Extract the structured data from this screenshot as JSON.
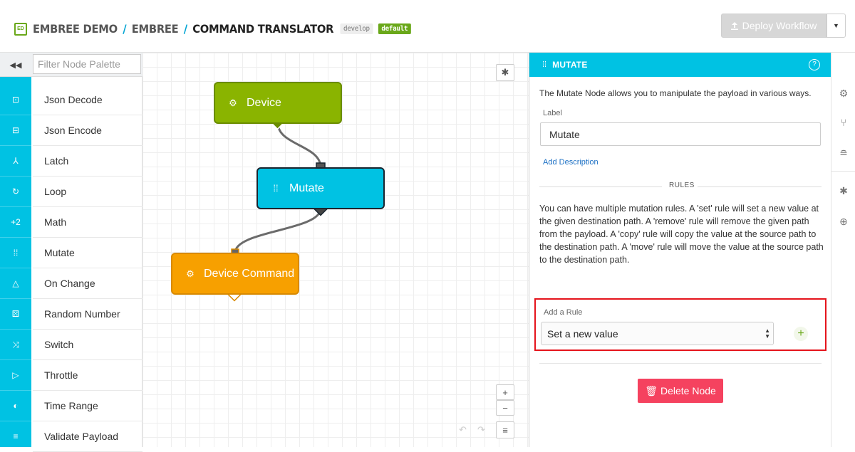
{
  "header": {
    "logo_text": "ED",
    "breadcrumbs": [
      "EMBREE DEMO",
      "EMBREE",
      "COMMAND TRANSLATOR"
    ],
    "separator": "/",
    "version_tag": "develop",
    "default_tag": "default",
    "deploy_label": "Deploy Workflow",
    "deploy_icon": "upload-icon",
    "caret_icon": "caret-down-icon"
  },
  "palette": {
    "filter_placeholder": "Filter Node Palette",
    "collapse_icon": "double-chevron-left-icon",
    "items": [
      {
        "label": "Json Decode",
        "icon": "json-decode-icon",
        "glyph": "⊡"
      },
      {
        "label": "Json Encode",
        "icon": "json-encode-icon",
        "glyph": "⊟"
      },
      {
        "label": "Latch",
        "icon": "latch-icon",
        "glyph": "⅄"
      },
      {
        "label": "Loop",
        "icon": "loop-icon",
        "glyph": "↻"
      },
      {
        "label": "Math",
        "icon": "math-icon",
        "glyph": "+2"
      },
      {
        "label": "Mutate",
        "icon": "mutate-icon",
        "glyph": "⁞⁞"
      },
      {
        "label": "On Change",
        "icon": "on-change-icon",
        "glyph": "△"
      },
      {
        "label": "Random Number",
        "icon": "dice-icon",
        "glyph": "⚄"
      },
      {
        "label": "Switch",
        "icon": "switch-icon",
        "glyph": "⤨"
      },
      {
        "label": "Throttle",
        "icon": "throttle-icon",
        "glyph": "▷"
      },
      {
        "label": "Time Range",
        "icon": "time-range-icon",
        "glyph": "◐"
      },
      {
        "label": "Validate Payload",
        "icon": "validate-icon",
        "glyph": "≡"
      }
    ]
  },
  "canvas": {
    "nodes": {
      "device": {
        "label": "Device",
        "icon": "chip-icon",
        "color": "#8ab400"
      },
      "mutate": {
        "label": "Mutate",
        "icon": "mutate-icon",
        "color": "#00c2e3"
      },
      "device_command": {
        "label": "Device Command",
        "icon": "chip-icon",
        "color": "#f7a000"
      }
    },
    "controls": {
      "debug_icon": "bug-icon",
      "zoom_in": "+",
      "zoom_out": "−",
      "menu_icon": "list-icon",
      "undo_icon": "undo-icon",
      "redo_icon": "redo-icon"
    }
  },
  "panel": {
    "title": "MUTATE",
    "help_icon": "question-icon",
    "description": "The Mutate Node allows you to manipulate the payload in various ways.",
    "label_title": "Label",
    "label_value": "Mutate",
    "add_description": "Add Description",
    "rules_heading": "RULES",
    "rules_text": "You can have multiple mutation rules. A 'set' rule will set a new value at the given destination path. A 'remove' rule will remove the given path from the payload. A 'copy' rule will copy the value at the source path to the destination path. A 'move' rule will move the value at the source path to the destination path.",
    "add_rule_label": "Add a Rule",
    "add_rule_selected": "Set a new value",
    "add_icon": "plus-icon",
    "delete_label": "Delete Node",
    "delete_icon": "trash-icon",
    "accent": "#00c2e3",
    "danger": "#f5425f"
  },
  "rail": {
    "icons": [
      "gear-icon",
      "branch-icon",
      "database-icon",
      "bug-icon",
      "globe-icon"
    ]
  }
}
